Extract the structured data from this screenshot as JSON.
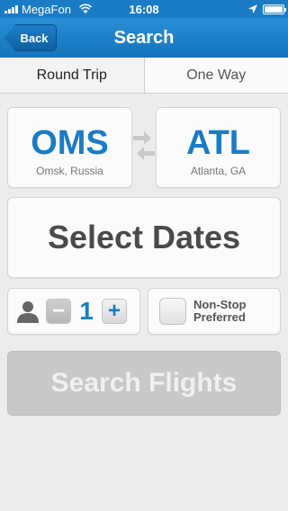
{
  "status_bar": {
    "carrier": "MegaFon",
    "time": "16:08"
  },
  "nav": {
    "title": "Search",
    "back_label": "Back"
  },
  "trip_type": {
    "options": [
      "Round Trip",
      "One Way"
    ],
    "selected": "Round Trip"
  },
  "origin": {
    "code": "OMS",
    "city": "Omsk, Russia"
  },
  "destination": {
    "code": "ATL",
    "city": "Atlanta, GA"
  },
  "dates": {
    "label": "Select Dates"
  },
  "passengers": {
    "count": "1",
    "minus": "−",
    "plus": "+"
  },
  "nonstop": {
    "label_line1": "Non-Stop",
    "label_line2": "Preferred",
    "checked": false
  },
  "search": {
    "label": "Search Flights"
  },
  "colors": {
    "accent": "#1a7cc4",
    "nav_bar": "#1a7cc4",
    "disabled_button": "#c8c8c8"
  },
  "icons": [
    "signal-icon",
    "wifi-icon",
    "location-arrow-icon",
    "battery-icon",
    "swap-arrows-icon",
    "person-icon",
    "checkbox-icon"
  ]
}
